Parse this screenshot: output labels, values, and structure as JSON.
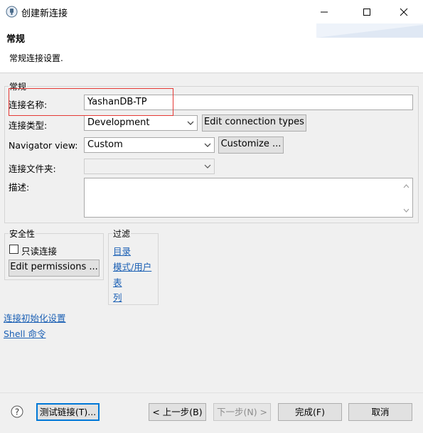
{
  "window": {
    "title": "创建新连接",
    "icon": "database-plug-icon"
  },
  "header": {
    "title": "常规",
    "description": "常规连接设置."
  },
  "general_group": {
    "label": "常规",
    "connection_name": {
      "label": "连接名称:",
      "value": "YashanDB-TP"
    },
    "connection_type": {
      "label": "连接类型:",
      "selected": "Development",
      "edit_button": "Edit connection types"
    },
    "navigator_view": {
      "label": "Navigator view:",
      "selected": "Custom",
      "customize_button": "Customize ..."
    },
    "connection_folder": {
      "label": "连接文件夹:",
      "selected": ""
    },
    "description": {
      "label": "描述:",
      "value": ""
    }
  },
  "security_group": {
    "label": "安全性",
    "readonly_label": "只读连接",
    "readonly_checked": false,
    "edit_permissions_button": "Edit permissions ..."
  },
  "filter_group": {
    "label": "过滤",
    "links": [
      "目录",
      "模式/用户",
      "表",
      "列"
    ]
  },
  "links": {
    "init_settings": "连接初始化设置",
    "shell_commands": "Shell 命令"
  },
  "footer": {
    "test_connection": "测试链接(T)...",
    "back": "< 上一步(B)",
    "next": "下一步(N) >",
    "finish": "完成(F)",
    "cancel": "取消"
  },
  "colors": {
    "highlight_box": "#e53935",
    "link": "#1a5fb4",
    "default_button_border": "#0078d7"
  }
}
